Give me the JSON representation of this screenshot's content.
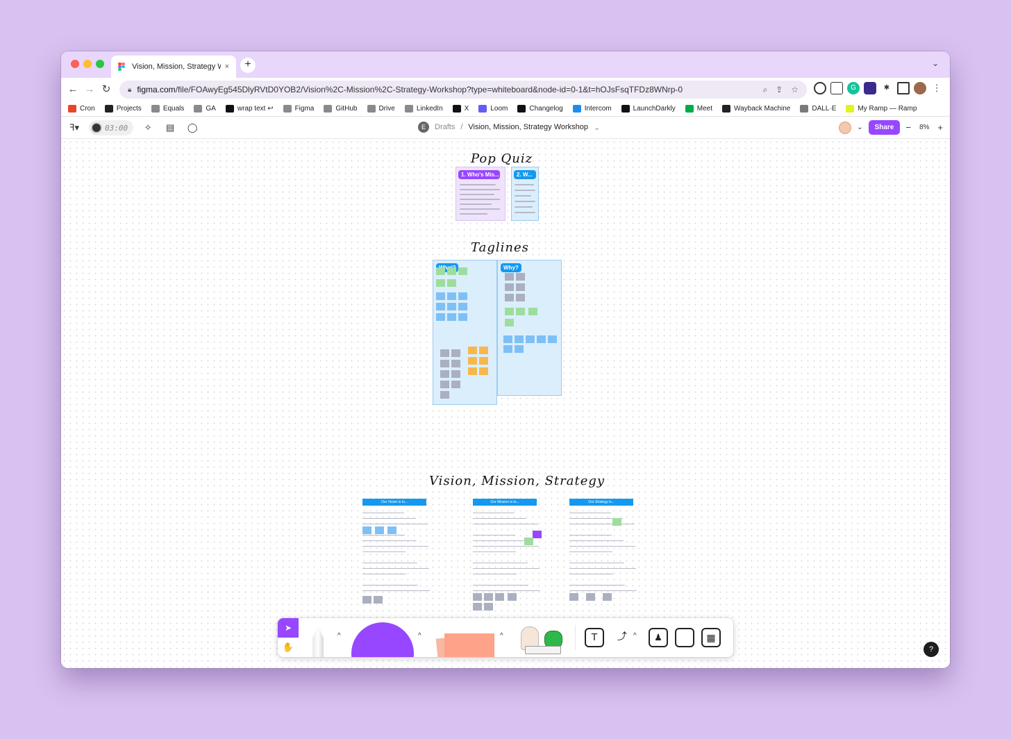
{
  "browser": {
    "tab_title": "Vision, Mission, Strategy Work",
    "tab_close": "×",
    "new_tab": "+",
    "tab_menu": "⌄",
    "url_host": "figma.com",
    "url_path": "/file/FOAwyEg545DlyRVtD0YOB2/Vision%2C-Mission%2C-Strategy-Workshop?type=whiteboard&node-id=0-1&t=hOJsFsqTFDz8WNrp-0",
    "back": "←",
    "forward": "→",
    "reload": "↻",
    "bookmarks": [
      {
        "label": "Cron",
        "color": "#e8442a"
      },
      {
        "label": "Projects",
        "color": "#222222"
      },
      {
        "label": "Equals",
        "color": "#8a8a8a"
      },
      {
        "label": "GA",
        "color": "#8a8a8a"
      },
      {
        "label": "wrap text ↩",
        "color": "#111111"
      },
      {
        "label": "Figma",
        "color": "#8a8a8a"
      },
      {
        "label": "GitHub",
        "color": "#8a8a8a"
      },
      {
        "label": "Drive",
        "color": "#8a8a8a"
      },
      {
        "label": "LinkedIn",
        "color": "#8a8a8a"
      },
      {
        "label": "X",
        "color": "#111111"
      },
      {
        "label": "Loom",
        "color": "#625df5"
      },
      {
        "label": "Changelog",
        "color": "#111111"
      },
      {
        "label": "Intercom",
        "color": "#1f8ded"
      },
      {
        "label": "LaunchDarkly",
        "color": "#111111"
      },
      {
        "label": "Meet",
        "color": "#00ac47"
      },
      {
        "label": "Wayback Machine",
        "color": "#222222"
      },
      {
        "label": "DALL·E",
        "color": "#7a7a7a"
      },
      {
        "label": "My Ramp — Ramp",
        "color": "#e4f222"
      }
    ]
  },
  "figma": {
    "timer": "03:00",
    "avatar_initial": "E",
    "drafts": "Drafts",
    "separator": "/",
    "file_name": "Vision, Mission, Strategy Workshop",
    "file_chevron": "⌄",
    "share": "Share",
    "zoom_out": "−",
    "zoom": "8%",
    "zoom_in": "+",
    "accent": "#9747ff"
  },
  "canvas": {
    "section1_title": "Pop Quiz",
    "quiz_card_1": "1. Who's Mis...",
    "quiz_card_2": "2. W...",
    "section2_title": "Taglines",
    "tagline_what": "What?",
    "tagline_why": "Why?",
    "section3_title": "Vision, Mission, Strategy",
    "doc_vision": "Our Vision is to...",
    "doc_mission": "Our Mission is to...",
    "doc_strategy": "Our Strategy is..."
  },
  "dock": {
    "move_icon": "➤",
    "hand_icon": "✋",
    "caret": "^",
    "text_tool": "T",
    "help": "?"
  }
}
